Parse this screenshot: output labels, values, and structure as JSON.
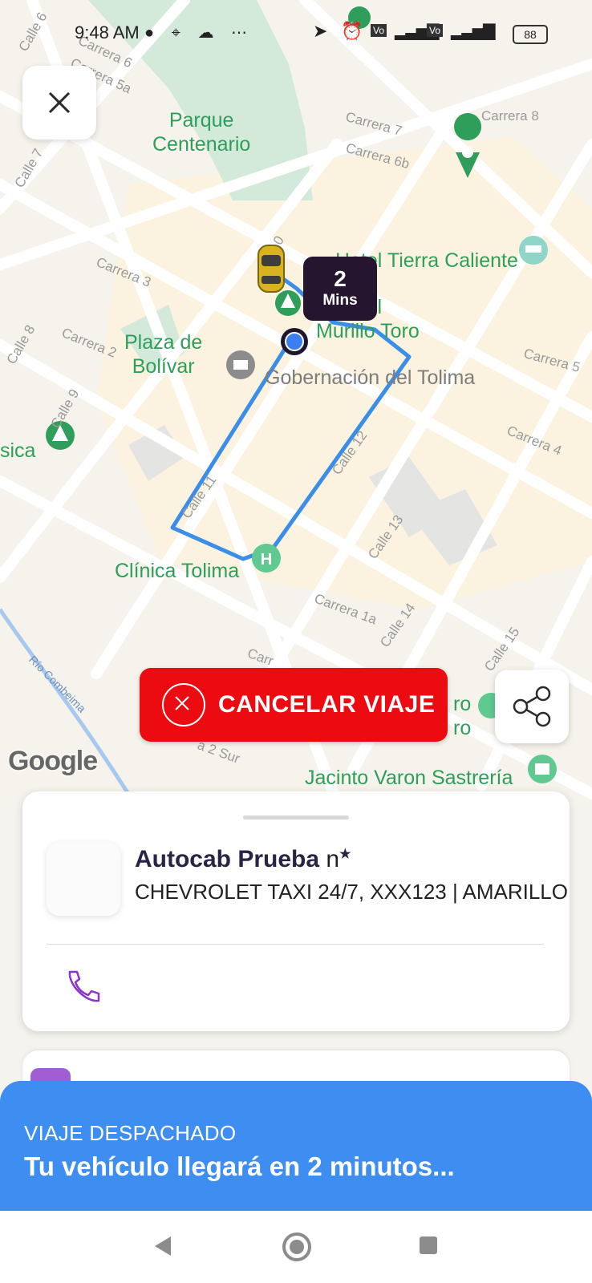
{
  "status_bar": {
    "time": "9:48 AM",
    "left_icons": [
      "chat-bubble-icon",
      "location-pin-icon",
      "cloud-icon",
      "more-dots-icon"
    ],
    "battery": "88",
    "right_icons": [
      "navigation-arrow-icon",
      "alarm-icon",
      "volte-icon",
      "signal-icon",
      "wifi-icon"
    ]
  },
  "map": {
    "labels": {
      "parque": "Parque\nCentenario",
      "hotel": "Hotel Tierra Caliente",
      "manuel": "Manuel\nMurillo Toro",
      "plaza": "Plaza de\nBolívar",
      "gobernacion": "Gobernación del Tolima",
      "clinica": "Clínica Tolima",
      "sica": "sica",
      "jacinto": "Jacinto Varon Sastrería",
      "ro1": "ro",
      "ro2": "ro"
    },
    "streets": {
      "calle6": "Calle 6",
      "carrera6": "Carrera 6",
      "carrera5a": "Carrera 5a",
      "carrera7": "Carrera 7",
      "carrera6b": "Carrera 6b",
      "carrera8": "Carrera 8",
      "calle7": "Calle 7",
      "calle10": "0",
      "carrera3": "Carrera 3",
      "carrera2": "Carrera 2",
      "calle8": "Calle 8",
      "carrera5": "Carrera 5",
      "calle9": "Calle 9",
      "carrera4": "Carrera 4",
      "calle12": "Calle 12",
      "calle11": "Calle 11",
      "calle13": "Calle 13",
      "carrera1a": "Carrera 1a",
      "calle14": "Calle 14",
      "calle15": "Calle 15",
      "rio": "Río Combeima",
      "carr": "Carr",
      "sur": "a 2 Sur"
    },
    "eta": {
      "value": "2",
      "unit": "Mins"
    },
    "google": "Google"
  },
  "buttons": {
    "cancel": "CANCELAR VIAJE"
  },
  "driver": {
    "name": "Autocab Prueba",
    "rating": "n",
    "star": "★",
    "vehicle": "CHEVROLET TAXI 24/7, XXX123 | AMARILLO"
  },
  "dispatch": {
    "status": "VIAJE DESPACHADO",
    "message": "Tu vehículo llegará en 2 minutos..."
  },
  "colors": {
    "cancel": "#ec0b10",
    "banner": "#3d8ef0",
    "route": "#3b8ee8",
    "eta_bg": "#25152f",
    "phone": "#8a35c7",
    "poi": "#2f9e5a"
  }
}
